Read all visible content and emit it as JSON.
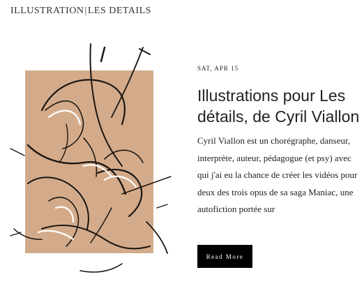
{
  "breadcrumb": {
    "category": "ILLUSTRATION",
    "separator": "|",
    "subcategory": "LES DETAILS"
  },
  "post": {
    "date": "SAT, APR 15",
    "title": "Illustrations pour Les détails, de Cyril Viallon",
    "excerpt": "Cyril Viallon est un chorégraphe, danseur, interprète, auteur, pédagogue (et psy) avec qui j'ai eu la chance de créer les vidéos pour deux des trois opus de sa saga Maniac, une autofiction portée sur",
    "read_more_label": "Read More"
  },
  "colors": {
    "paper_background": "#d4ab8a",
    "ink": "#1a1612",
    "button_background": "#000000",
    "button_text": "#ffffff"
  }
}
